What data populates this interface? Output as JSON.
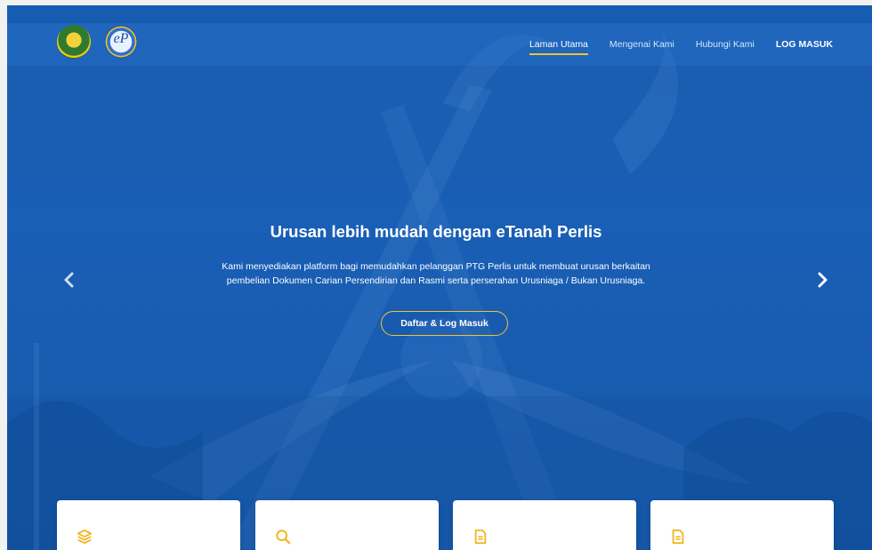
{
  "header": {
    "logos": [
      {
        "name": "perlis-state-crest",
        "alt": ""
      },
      {
        "name": "etanah-perlis-logo",
        "alt": ""
      }
    ],
    "nav": [
      {
        "label": "Laman Utama",
        "active": true
      },
      {
        "label": "Mengenai Kami",
        "active": false
      },
      {
        "label": "Hubungi Kami",
        "active": false
      },
      {
        "label": "LOG MASUK",
        "active": false
      }
    ]
  },
  "hero": {
    "title": "Urusan lebih mudah dengan eTanah Perlis",
    "description_line1": "Kami menyediakan platform bagi memudahkan pelanggan PTG Perlis untuk membuat urusan berkaitan",
    "description_line2": "pembelian Dokumen Carian Persendirian dan Rasmi serta perserahan Urusniaga / Bukan Urusniaga.",
    "cta_label": "Daftar & Log Masuk",
    "arrow_left_glyph": "‹",
    "arrow_right_glyph": "›"
  },
  "cards": [
    {
      "icon": "layers-icon"
    },
    {
      "icon": "search-icon"
    },
    {
      "icon": "document-icon"
    },
    {
      "icon": "document-icon"
    }
  ],
  "colors": {
    "accent": "#f2c230",
    "hero_blue": "#1d63b6",
    "card_icon": "#f2b51e"
  }
}
